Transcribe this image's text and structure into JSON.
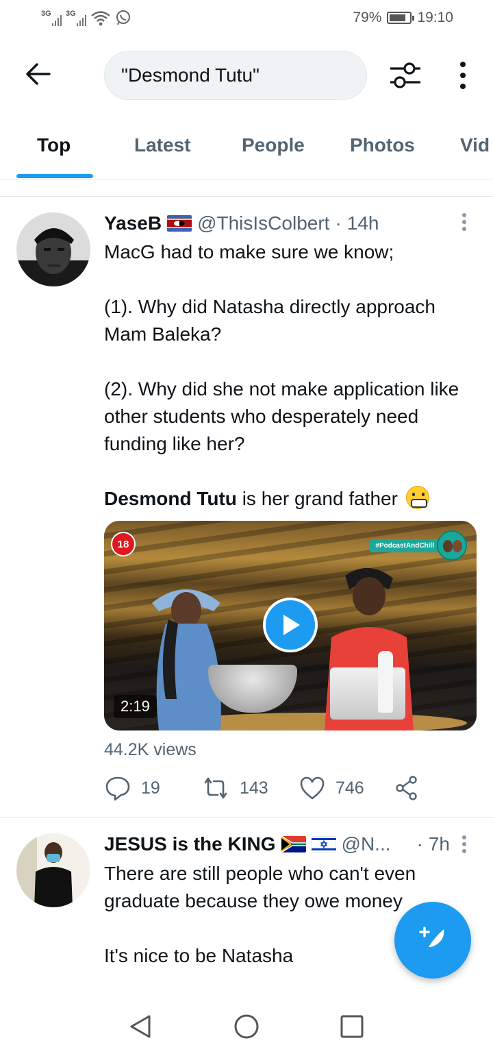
{
  "status_bar": {
    "signal_1": "3G",
    "signal_2": "3G",
    "battery_percent": "79%",
    "battery_level": 0.79,
    "time": "19:10"
  },
  "search": {
    "query": "\"Desmond Tutu\""
  },
  "tabs": [
    {
      "label": "Top",
      "active": true
    },
    {
      "label": "Latest",
      "active": false
    },
    {
      "label": "People",
      "active": false
    },
    {
      "label": "Photos",
      "active": false
    },
    {
      "label": "Vid",
      "active": false
    }
  ],
  "tweets": [
    {
      "name": "YaseB",
      "flag": "eswatini-flag",
      "handle": "@ThisIsColbert",
      "separator": "·",
      "time": "14h",
      "text": {
        "line1": "MacG had to make sure we know;",
        "para2": "(1). Why did Natasha directly approach Mam Baleka?",
        "para3": "(2). Why did  she not make application like other students who desperately need funding like her?",
        "highlight": "Desmond Tutu",
        "para4_rest": " is her grand father"
      },
      "video": {
        "age_badge": "18",
        "channel_tag": "#PodcastAndChill",
        "duration": "2:19"
      },
      "views": "44.2K views",
      "actions": {
        "replies": "19",
        "retweets": "143",
        "likes": "746"
      }
    },
    {
      "name": "JESUS is the KING",
      "flags": [
        "south-africa-flag",
        "israel-flag"
      ],
      "handle": "@N...",
      "separator": "·",
      "time": "7h",
      "text": {
        "para1": "There are still people who can't even graduate because they owe money",
        "para2": "It's nice to be Natasha"
      }
    }
  ],
  "colors": {
    "accent": "#1d9bf0",
    "text_primary": "#0f1419",
    "text_secondary": "#536471"
  }
}
